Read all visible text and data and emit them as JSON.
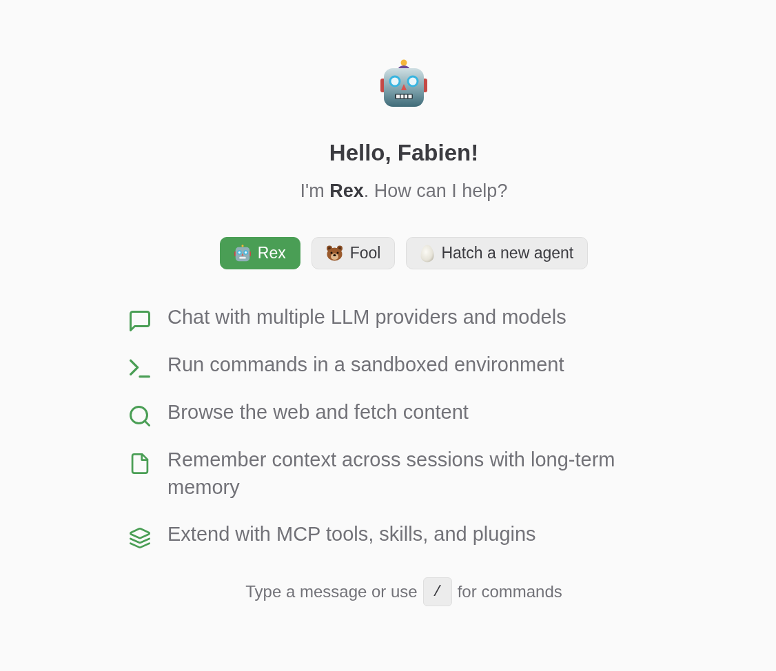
{
  "greeting": {
    "title": "Hello, Fabien!",
    "subtitle": "I'm **Rex**. How can I help?"
  },
  "agents": [
    {
      "label": "Rex",
      "selected": true
    },
    {
      "label": "Fool",
      "selected": false
    }
  ],
  "hatch_button": {
    "label": "Hatch a new agent"
  },
  "features": [
    {
      "text": "Chat with multiple LLM providers and models"
    },
    {
      "text": "Run commands in a sandboxed environment"
    },
    {
      "text": "Browse the web and fetch content"
    },
    {
      "text": "Remember context across sessions with long-term memory"
    },
    {
      "text": "Extend with MCP tools, skills, and plugins"
    }
  ],
  "footer_hint": {
    "before": "Type a message or use",
    "key": "/",
    "after": "for commands"
  }
}
